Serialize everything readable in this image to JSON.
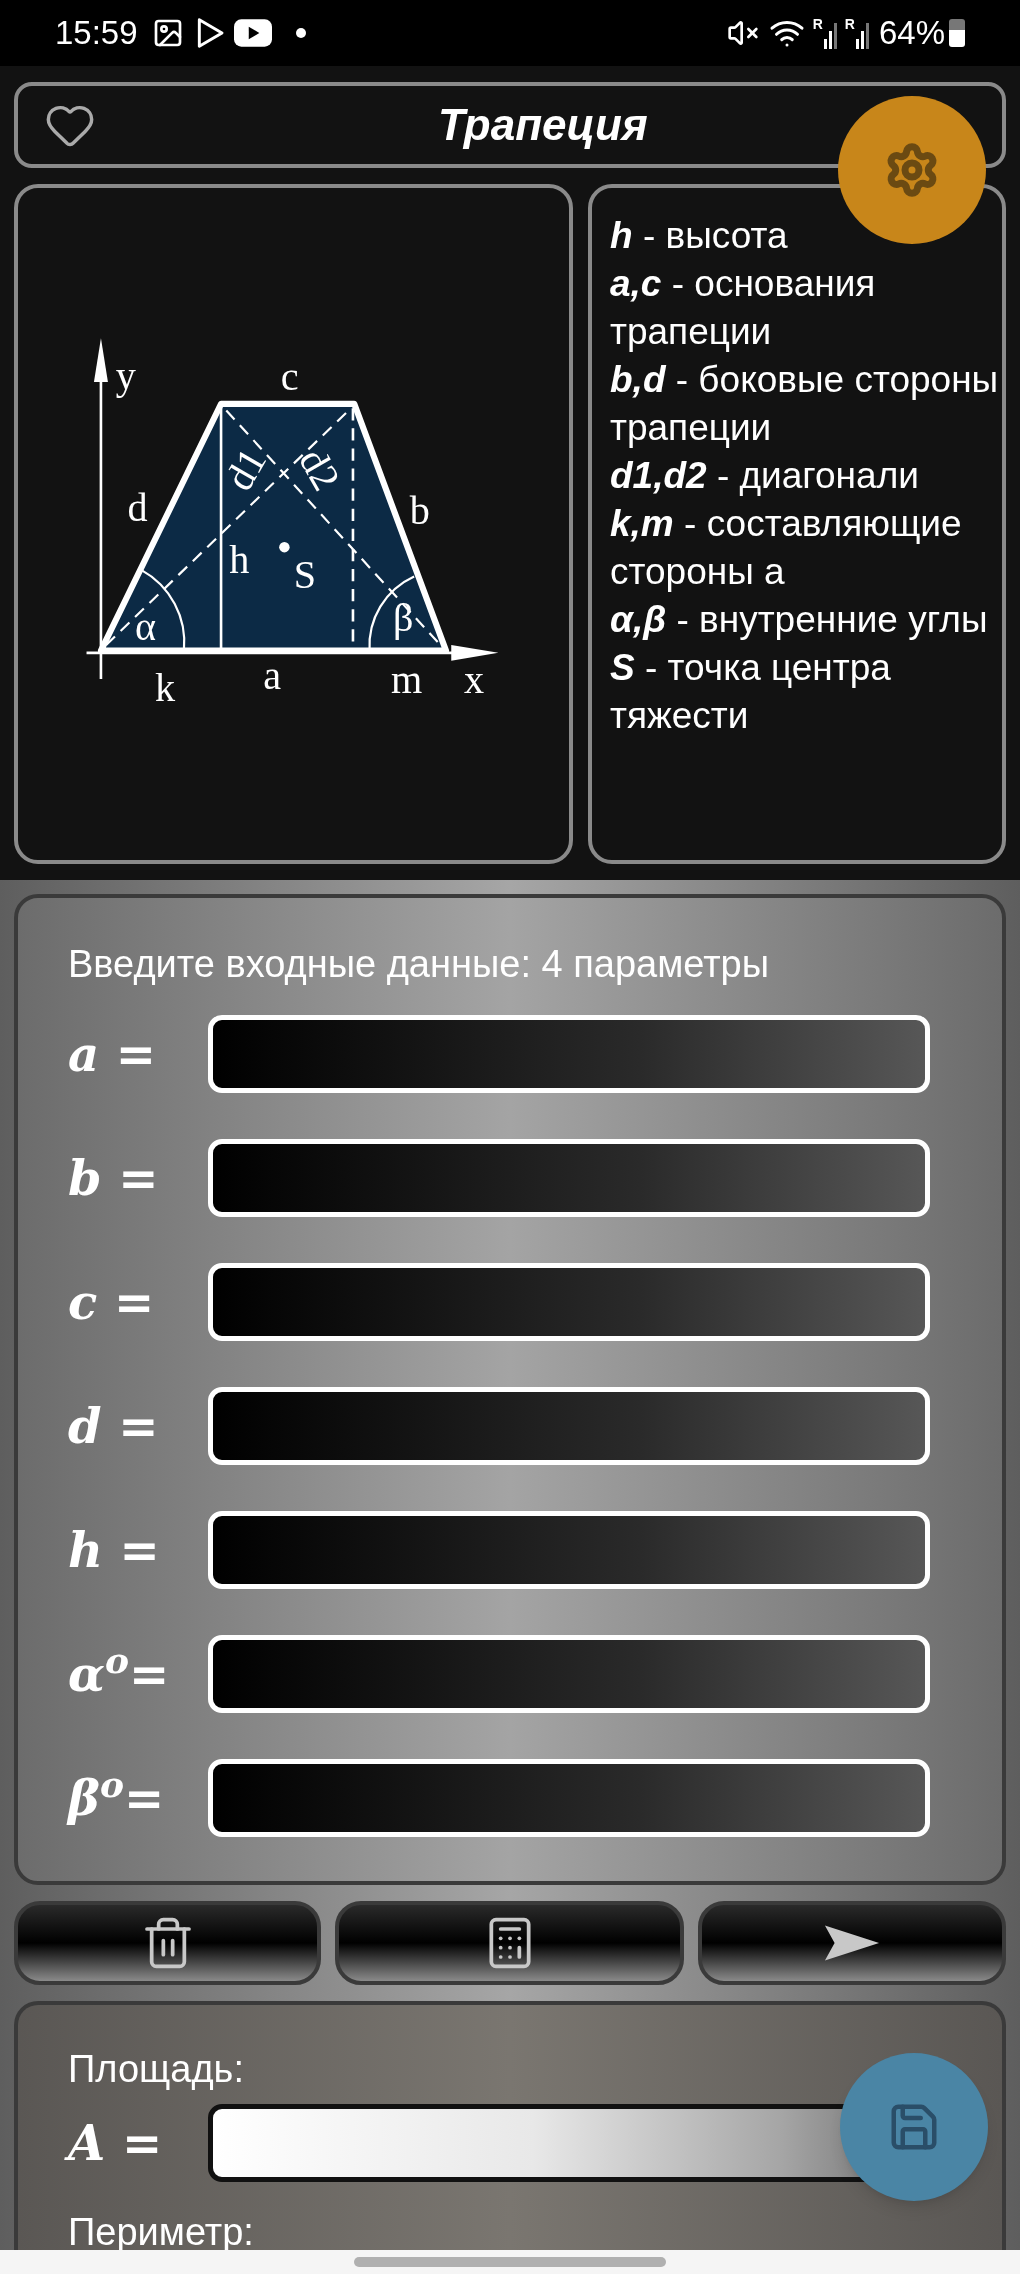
{
  "status_bar": {
    "time": "15:59",
    "battery": "64%",
    "signals": [
      {
        "label": "R"
      },
      {
        "label": "R"
      }
    ]
  },
  "header": {
    "title": "Трапеция",
    "favorite": false
  },
  "diagram": {
    "labels": [
      "y",
      "c",
      "d",
      "d1",
      "d2",
      "b",
      "h",
      "S",
      "α",
      "β",
      "k",
      "a",
      "m",
      "x"
    ]
  },
  "legend": [
    {
      "term": "h",
      "text": "- высота"
    },
    {
      "term": "a,c",
      "text": "- основания трапеции"
    },
    {
      "term": "b,d",
      "text": "- боковые стороны трапеции"
    },
    {
      "term": "d1,d2",
      "text": "- диагонали"
    },
    {
      "term": "k,m",
      "text": "- составляющие стороны a"
    },
    {
      "term": "α,β",
      "text": "- внутренние углы"
    },
    {
      "term": "S",
      "text": "- точка центра тяжести"
    }
  ],
  "input_panel": {
    "prompt": "Введите входные данные: 4 параметры",
    "fields": [
      {
        "label": "a ="
      },
      {
        "label": "b ="
      },
      {
        "label": "c ="
      },
      {
        "label": "d ="
      },
      {
        "label": "h ="
      },
      {
        "label": "α$^{o}$="
      },
      {
        "label": "β$^{o}$="
      }
    ]
  },
  "actions": [
    {
      "kind": "clear"
    },
    {
      "kind": "calculate"
    },
    {
      "kind": "send"
    }
  ],
  "results": {
    "fields": [
      {
        "heading": "Площадь:",
        "label": "A ="
      }
    ],
    "next_heading": "Периметр:"
  }
}
